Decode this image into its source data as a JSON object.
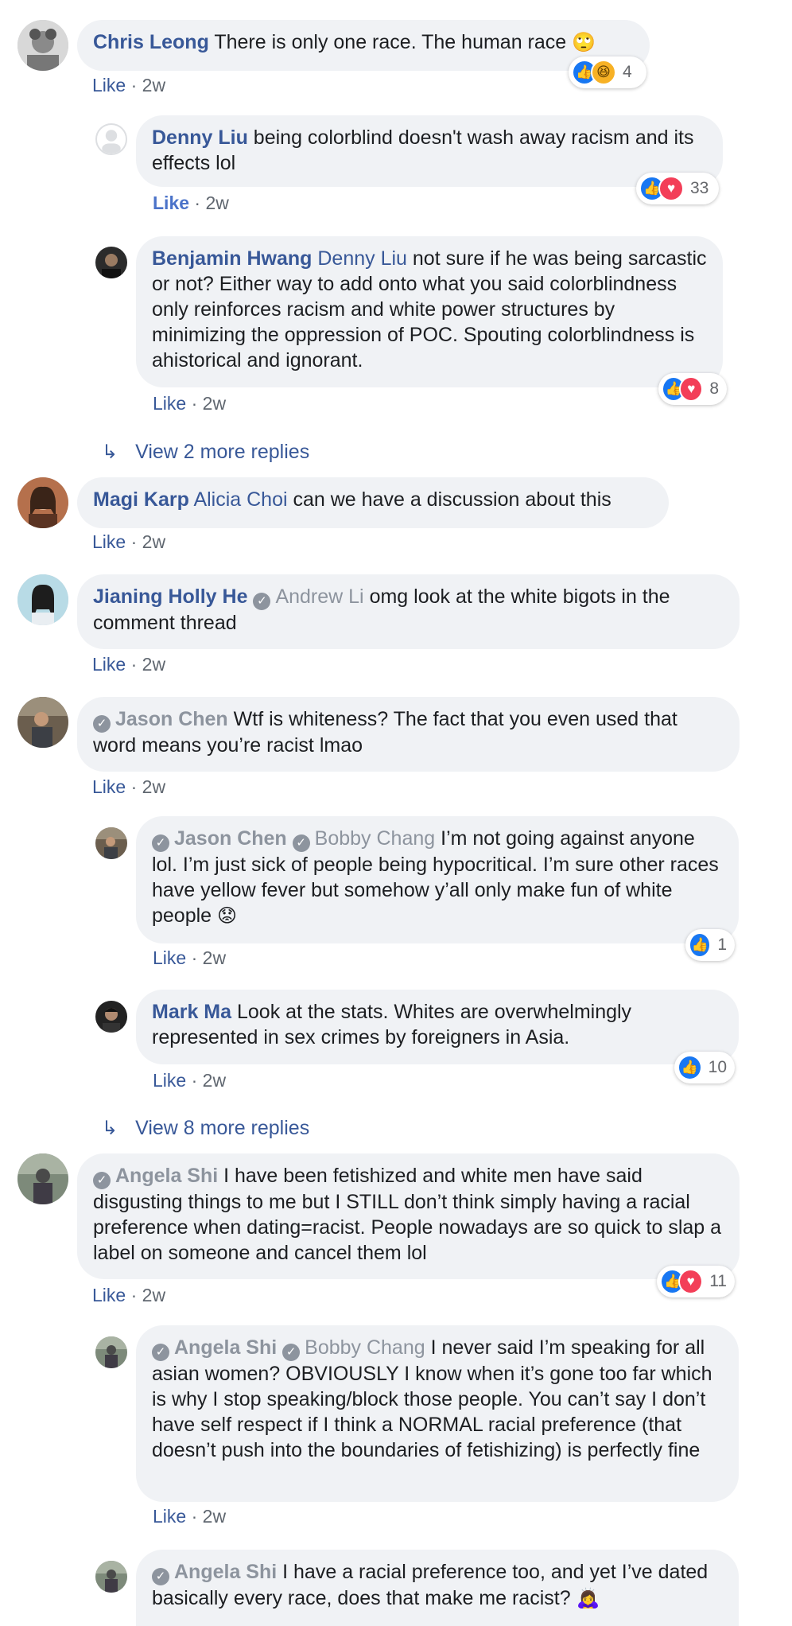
{
  "ui": {
    "like_label": "Like",
    "dot": " · "
  },
  "comments": [
    {
      "name": "Chris Leong",
      "text": "There is only one race. The human race",
      "emoji": "🙄",
      "time": "2w",
      "reaction_count": "4"
    },
    {
      "name": "Denny Liu",
      "text": "being colorblind doesn't wash away racism and its effects lol",
      "time": "2w",
      "reaction_count": "33"
    },
    {
      "name": "Benjamin Hwang",
      "mention": "Denny Liu",
      "text": "not sure if he was being sarcastic or not? Either way to add onto what you said colorblindness only reinforces racism and white power structures by minimizing the oppression of POC. Spouting colorblindness is ahistorical and ignorant.",
      "time": "2w",
      "reaction_count": "8"
    },
    {
      "name": "Magi Karp",
      "mention": "Alicia Choi",
      "text": "can we have a discussion about this",
      "time": "2w"
    },
    {
      "name": "Jianing Holly He",
      "mention": "Andrew Li",
      "text": "omg look at the white bigots in the comment thread",
      "time": "2w"
    },
    {
      "name": "Jason Chen",
      "text": "Wtf is whiteness? The fact that you even used that word means you’re racist lmao",
      "time": "2w"
    },
    {
      "name": "Jason Chen",
      "mention": "Bobby Chang",
      "text": "I’m not going against anyone lol. I’m just sick of people being hypocritical. I’m sure other races have yellow fever but somehow y’all only make fun of white people",
      "emoji": "😟",
      "time": "2w",
      "reaction_count": "1"
    },
    {
      "name": "Mark Ma",
      "text": "Look at the stats. Whites are overwhelmingly represented in sex crimes by foreigners in Asia.",
      "time": "2w",
      "reaction_count": "10"
    },
    {
      "name": "Angela Shi",
      "text": "I have been fetishized and white men have said disgusting things to me but I STILL don’t think simply having a racial preference when dating=racist. People nowadays are so quick to slap a label on someone and cancel them lol",
      "time": "2w",
      "reaction_count": "11"
    },
    {
      "name": "Angela Shi",
      "mention": "Bobby Chang",
      "text": "I never said I’m speaking for all asian women? OBVIOUSLY I know when it’s gone too far which is why I stop speaking/block those people. You can’t say I don’t have self respect if I think a NORMAL racial preference (that doesn’t push into the boundaries of fetishizing) is perfectly fine",
      "time": "2w"
    },
    {
      "name": "Angela Shi",
      "text": "I have a racial preference too, and yet I’ve dated basically every race, does that make me racist?",
      "emoji": "🙇‍♀️"
    }
  ],
  "more_replies": [
    {
      "label": "View 2 more replies"
    },
    {
      "label": "View 8 more replies"
    }
  ],
  "colors": {
    "bubble": "#f0f2f5",
    "link": "#385898",
    "like_reaction": "#1877f2",
    "love_reaction": "#f33e58",
    "haha_reaction": "#f7b125"
  }
}
